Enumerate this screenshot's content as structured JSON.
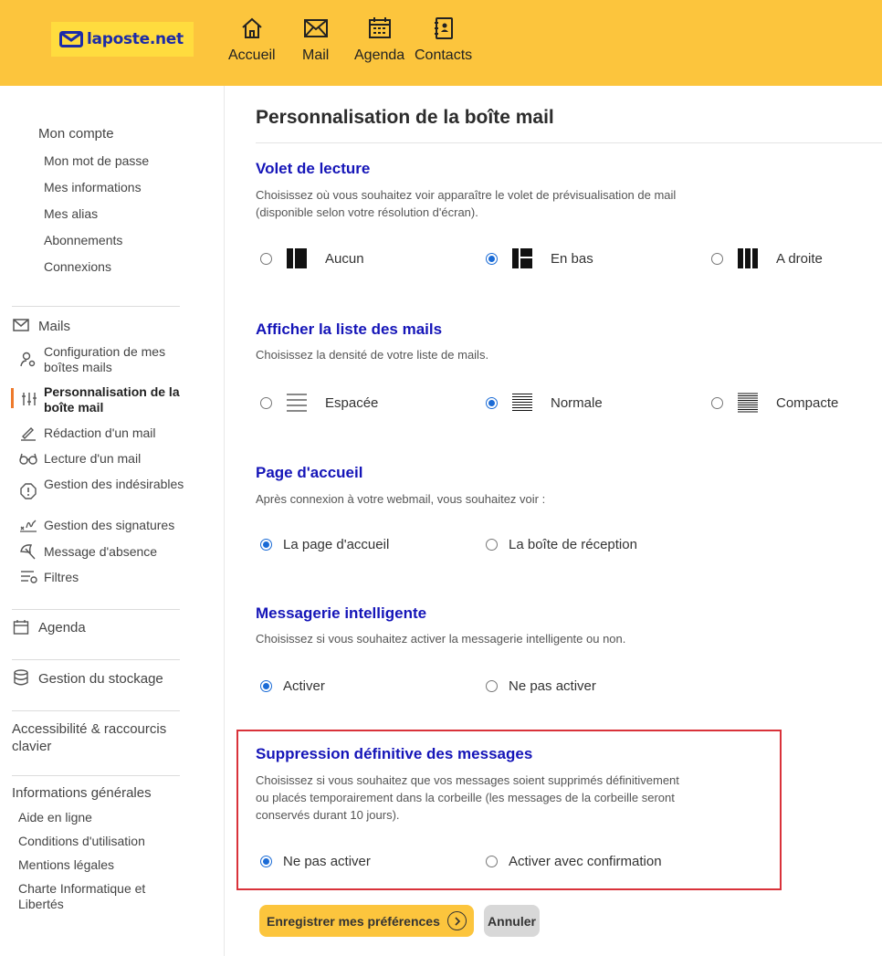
{
  "header": {
    "logo_text": "laposte.net",
    "nav": [
      {
        "label": "Accueil",
        "icon": "home-icon"
      },
      {
        "label": "Mail",
        "icon": "mail-icon"
      },
      {
        "label": "Agenda",
        "icon": "calendar-icon"
      },
      {
        "label": "Contacts",
        "icon": "contacts-icon"
      }
    ]
  },
  "sidebar": {
    "account": {
      "heading": "Mon compte",
      "items": [
        "Mon mot de passe",
        "Mes informations",
        "Mes alias",
        "Abonnements",
        "Connexions"
      ]
    },
    "mails": {
      "heading": "Mails",
      "items": [
        {
          "label": "Configuration de mes boîtes mails",
          "icon": "user-gear-icon"
        },
        {
          "label": "Personnalisation de la boîte mail",
          "icon": "sliders-icon",
          "active": true
        },
        {
          "label": "Rédaction d'un mail",
          "icon": "pencil-icon"
        },
        {
          "label": "Lecture d'un mail",
          "icon": "glasses-icon"
        },
        {
          "label": "Gestion des indésirables",
          "icon": "warning-icon"
        },
        {
          "label": "Gestion des signatures",
          "icon": "signature-icon"
        },
        {
          "label": "Message d'absence",
          "icon": "beach-umbrella-icon"
        },
        {
          "label": "Filtres",
          "icon": "filter-icon"
        }
      ]
    },
    "agenda": "Agenda",
    "storage": "Gestion du stockage",
    "accessibility": "Accessibilité & raccourcis clavier",
    "general": {
      "heading": "Informations générales",
      "items": [
        "Aide en ligne",
        "Conditions d'utilisation",
        "Mentions légales",
        "Charte Informatique et Libertés"
      ]
    }
  },
  "main": {
    "title": "Personnalisation de la boîte mail",
    "sections": [
      {
        "title": "Volet de lecture",
        "desc": "Choisissez où vous souhaitez voir apparaître le volet de prévisualisation de mail (disponible selon votre résolution d'écran).",
        "options": [
          {
            "label": "Aucun",
            "checked": false
          },
          {
            "label": "En bas",
            "checked": true
          },
          {
            "label": "A droite",
            "checked": false
          }
        ]
      },
      {
        "title": "Afficher la liste des mails",
        "desc": "Choisissez la densité de votre liste de mails.",
        "options": [
          {
            "label": "Espacée",
            "checked": false
          },
          {
            "label": "Normale",
            "checked": true
          },
          {
            "label": "Compacte",
            "checked": false
          }
        ]
      },
      {
        "title": "Page d'accueil",
        "desc": "Après connexion à votre webmail, vous souhaitez voir :",
        "options": [
          {
            "label": "La page d'accueil",
            "checked": true
          },
          {
            "label": "La boîte de réception",
            "checked": false
          }
        ]
      },
      {
        "title": "Messagerie intelligente",
        "desc": "Choisissez si vous souhaitez activer la messagerie intelligente ou non.",
        "options": [
          {
            "label": "Activer",
            "checked": true
          },
          {
            "label": "Ne pas activer",
            "checked": false
          }
        ]
      },
      {
        "title": "Suppression définitive des messages",
        "desc": "Choisissez si vous souhaitez que vos messages soient supprimés définitivement ou placés temporairement dans la corbeille (les messages de la corbeille seront conservés durant 10 jours).",
        "options": [
          {
            "label": "Ne pas activer",
            "checked": true
          },
          {
            "label": "Activer avec confirmation",
            "checked": false
          }
        ]
      }
    ],
    "save_label": "Enregistrer mes préférences",
    "cancel_label": "Annuler"
  },
  "colors": {
    "header_bg": "#fcc53d",
    "section_title": "#1515b8",
    "radio_checked": "#1a6bd6",
    "active_indicator": "#ee7a2c",
    "highlight_border": "#d9323a"
  }
}
